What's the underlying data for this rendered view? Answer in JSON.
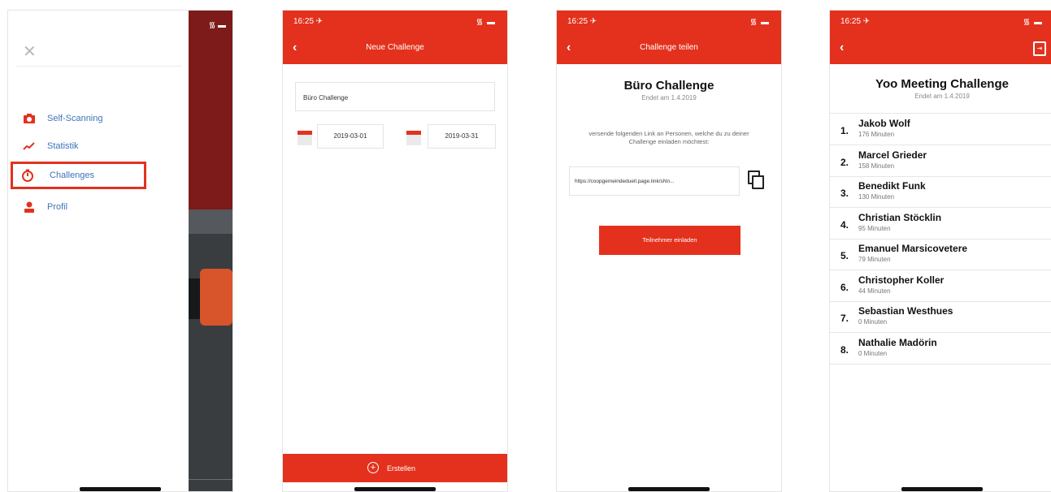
{
  "screen1": {
    "close_icon": "close-icon",
    "menu": [
      {
        "label": "Self-Scanning",
        "icon": "camera-icon"
      },
      {
        "label": "Statistik",
        "icon": "chart-icon"
      },
      {
        "label": "Challenges",
        "icon": "stopwatch-icon"
      },
      {
        "label": "Profil",
        "icon": "person-icon"
      }
    ]
  },
  "screen2": {
    "time": "16:25 ✈",
    "signal": "᯾ ▬",
    "nav_title": "Neue Challenge",
    "name_value": "Büro Challenge",
    "start_date": "2019-03-01",
    "end_date": "2019-03-31",
    "create_label": "Erstellen"
  },
  "screen3": {
    "time": "16:25 ✈",
    "signal": "᯾ ▬",
    "nav_title": "Challenge teilen",
    "title": "Büro Challenge",
    "subtitle": "Endet am 1.4.2019",
    "description": "versende folgenden Link an Personen, welche du zu deiner Challenge einladen möchtest:",
    "link": "https://coopgemeindeduell.page.link/sNn...",
    "invite_label": "Teilnehmer einladen"
  },
  "screen4": {
    "time": "16:25 ✈",
    "signal": "᯾ ▬",
    "title": "Yoo Meeting Challenge",
    "subtitle": "Endet am 1.4.2019",
    "ranking": [
      {
        "rank": "1.",
        "name": "Jakob Wolf",
        "minutes": "176 Minuten"
      },
      {
        "rank": "2.",
        "name": "Marcel Grieder",
        "minutes": "158 Minuten"
      },
      {
        "rank": "3.",
        "name": "Benedikt Funk",
        "minutes": "130 Minuten"
      },
      {
        "rank": "4.",
        "name": "Christian Stöcklin",
        "minutes": "95 Minuten"
      },
      {
        "rank": "5.",
        "name": "Emanuel Marsicovetere",
        "minutes": "79 Minuten"
      },
      {
        "rank": "6.",
        "name": "Christopher Koller",
        "minutes": "44 Minuten"
      },
      {
        "rank": "7.",
        "name": "Sebastian Westhues",
        "minutes": "0 Minuten"
      },
      {
        "rank": "8.",
        "name": "Nathalie Madörin",
        "minutes": "0 Minuten"
      }
    ]
  },
  "colors": {
    "accent": "#e3311d",
    "link": "#3c74b8"
  }
}
